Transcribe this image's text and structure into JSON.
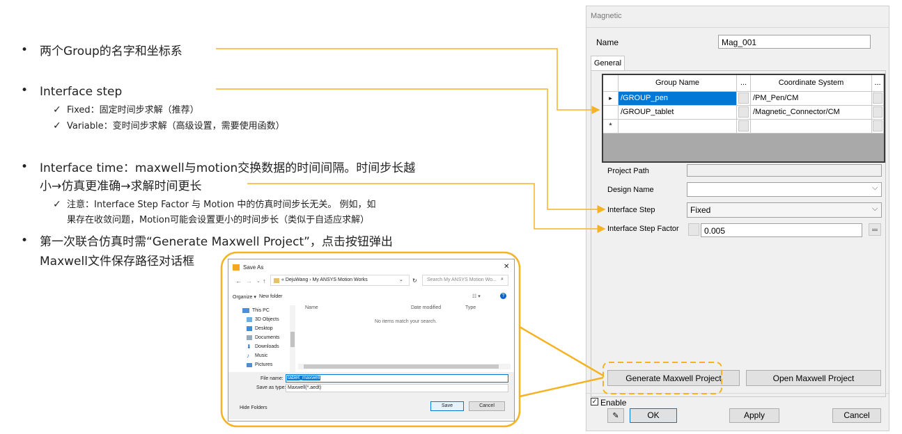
{
  "bullets": {
    "b1": "两个Group的名字和坐标系",
    "b2": "Interface step",
    "b2_sub1": "Fixed：固定时间步求解（推荐）",
    "b2_sub2": "Variable：变时间步求解（高级设置，需要使用函数）",
    "b3_line1": "Interface time：maxwell与motion交换数据的时间间隔。时间步长越",
    "b3_line2": "小→仿真更准确→求解时间更长",
    "b3_sub_line1": "注意：Interface Step Factor 与 Motion 中的仿真时间步长无关。 例如，如",
    "b3_sub_line2": "果存在收敛问题，Motion可能会设置更小的时间步长（类似于自适应求解）",
    "b4_line1": "第一次联合仿真时需“Generate Maxwell Project”，点击按钮弹出",
    "b4_line2": "Maxwell文件保存路径对话框",
    "bullet_char": "•",
    "check_char": "✓"
  },
  "colors": {
    "accent": "#f5b324",
    "selection": "#0078d7"
  },
  "dialog": {
    "title": "Magnetic",
    "name_label": "Name",
    "name_value": "Mag_001",
    "tab_general": "General",
    "table": {
      "col_group": "Group Name",
      "col_dots1": "...",
      "col_coord": "Coordinate System",
      "col_dots2": "...",
      "rows": [
        {
          "marker": "▸",
          "group": "/GROUP_pen",
          "coord": "/PM_Pen/CM"
        },
        {
          "marker": "",
          "group": "/GROUP_tablet",
          "coord": "/Magnetic_Connector/CM"
        },
        {
          "marker": "*",
          "group": "",
          "coord": ""
        }
      ]
    },
    "project_path_label": "Project Path",
    "project_path_value": "",
    "design_name_label": "Design Name",
    "design_name_value": "",
    "interface_step_label": "Interface Step",
    "interface_step_value": "Fixed",
    "interface_step_factor_label": "Interface Step Factor",
    "interface_step_factor_value": "0.005",
    "generate_btn": "Generate Maxwell Project",
    "open_btn": "Open Maxwell Project",
    "enable_label": "Enable",
    "ok_btn": "OK",
    "apply_btn": "Apply",
    "cancel_btn": "Cancel",
    "dropdown_arrow": "⌵"
  },
  "save_as": {
    "title": "Save As",
    "path": "« DejuWang › My ANSYS Motion Works",
    "search_placeholder": "Search My ANSYS Motion Wo...",
    "organize": "Organize ▾",
    "new_folder": "New folder",
    "col_name": "Name",
    "col_date": "Date modified",
    "col_type": "Type",
    "empty_msg": "No items match your search.",
    "tree": [
      "This PC",
      "3D Objects",
      "Desktop",
      "Documents",
      "Downloads",
      "Music",
      "Pictures"
    ],
    "file_name_label": "File name:",
    "file_name_value": "tablet_maxwell",
    "save_type_label": "Save as type:",
    "save_type_value": "Maxwell(*.aedt)",
    "hide_folders": "Hide Folders",
    "save_btn": "Save",
    "cancel_btn": "Cancel"
  }
}
